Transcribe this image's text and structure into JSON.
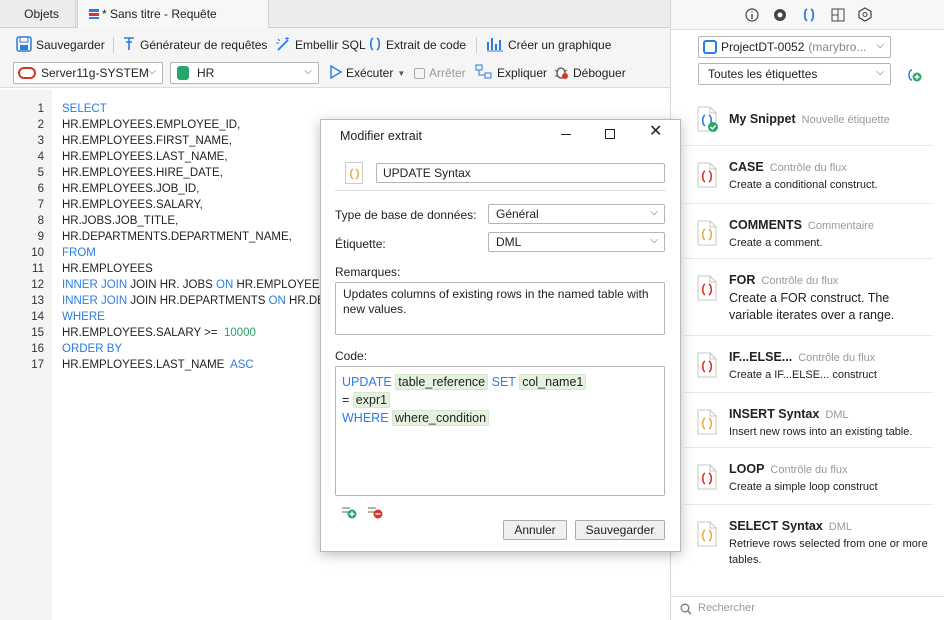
{
  "tabs": {
    "objects": "Objets",
    "query": "* Sans titre - Requête"
  },
  "toolbar": {
    "save": "Sauvegarder",
    "query_builder": "Générateur de requêtes",
    "beautify": "Embellir SQL",
    "code_snippet": "Extrait de code",
    "create_chart": "Créer un graphique",
    "connection": "Server11g-SYSTEM",
    "schema": "HR",
    "run": "Exécuter",
    "stop": "Arrêter",
    "explain": "Expliquer",
    "debug": "Déboguer"
  },
  "editor": {
    "lines": [
      {
        "n": "1",
        "parts": [
          {
            "t": "SELECT",
            "c": "kw"
          }
        ]
      },
      {
        "n": "2",
        "parts": [
          {
            "t": "HR.EMPLOYEES.EMPLOYEE_ID,"
          }
        ]
      },
      {
        "n": "3",
        "parts": [
          {
            "t": "HR.EMPLOYEES.FIRST_NAME,"
          }
        ]
      },
      {
        "n": "4",
        "parts": [
          {
            "t": "HR.EMPLOYEES.LAST_NAME,"
          }
        ]
      },
      {
        "n": "5",
        "parts": [
          {
            "t": "HR.EMPLOYEES.HIRE_DATE,"
          }
        ]
      },
      {
        "n": "6",
        "parts": [
          {
            "t": "HR.EMPLOYEES.JOB_ID,"
          }
        ]
      },
      {
        "n": "7",
        "parts": [
          {
            "t": "HR.EMPLOYEES.SALARY,"
          }
        ]
      },
      {
        "n": "8",
        "parts": [
          {
            "t": "HR.JOBS.JOB_TITLE,"
          }
        ]
      },
      {
        "n": "9",
        "parts": [
          {
            "t": "HR.DEPARTMENTS.DEPARTMENT_NAME,"
          }
        ]
      },
      {
        "n": "10",
        "parts": [
          {
            "t": "FROM",
            "c": "kw"
          }
        ]
      },
      {
        "n": "11",
        "parts": [
          {
            "t": "HR.EMPLOYEES"
          }
        ]
      },
      {
        "n": "12",
        "parts": [
          {
            "t": "INNER JOIN",
            "c": "kw"
          },
          {
            "t": " JOIN HR. JOBS "
          },
          {
            "t": "ON",
            "c": "kw"
          },
          {
            "t": " HR.EMPLOYEES"
          }
        ]
      },
      {
        "n": "13",
        "parts": [
          {
            "t": "INNER JOIN",
            "c": "kw"
          },
          {
            "t": " JOIN HR.DEPARTMENTS "
          },
          {
            "t": "ON",
            "c": "kw"
          },
          {
            "t": " HR.DE"
          }
        ]
      },
      {
        "n": "14",
        "parts": [
          {
            "t": "WHERE",
            "c": "kw"
          }
        ]
      },
      {
        "n": "15",
        "parts": [
          {
            "t": "HR.EMPLOYEES.SALARY >=  "
          },
          {
            "t": "10000",
            "c": "num"
          }
        ]
      },
      {
        "n": "16",
        "parts": [
          {
            "t": "ORDER BY",
            "c": "kw"
          }
        ]
      },
      {
        "n": "17",
        "parts": [
          {
            "t": "HR.EMPLOYEES.LAST_NAME  "
          },
          {
            "t": "ASC",
            "c": "kw"
          }
        ]
      }
    ]
  },
  "dialog": {
    "title": "Modifier extrait",
    "name": "UPDATE Syntax",
    "db_type_label": "Type de base de données:",
    "db_type_value": "Général",
    "tag_label": "Étiquette:",
    "tag_value": "DML",
    "remarks_label": "Remarques:",
    "remarks_value": "Updates columns of existing rows in the named table with new values.",
    "code_label": "Code:",
    "code": {
      "kw_update": "UPDATE",
      "tok_table": "table_reference",
      "kw_set": "SET",
      "tok_col": "col_name1",
      "eq": "=",
      "tok_expr": "expr1",
      "kw_where": "WHERE",
      "tok_where": "where_condition"
    },
    "cancel": "Annuler",
    "save": "Sauvegarder"
  },
  "panel": {
    "project": "ProjectDT-0052",
    "project_user": "(marybro...",
    "tag_filter": "Toutes les étiquettes",
    "search_placeholder": "Rechercher",
    "snippets": [
      {
        "title": "My Snippet",
        "tag": "Nouvelle étiquette",
        "desc": "",
        "color": "#2a7de1"
      },
      {
        "title": "CASE",
        "tag": "Contrôle du flux",
        "desc": "Create a conditional construct.",
        "color": "#d9342b"
      },
      {
        "title": "COMMENTS",
        "tag": "Commentaire",
        "desc": "Create a comment.",
        "color": "#e0b341"
      },
      {
        "title": "FOR",
        "tag": "Contrôle du flux",
        "desc": "Create a FOR construct. The variable iterates over a range.",
        "color": "#d9342b"
      },
      {
        "title": "IF...ELSE...",
        "tag": "Contrôle du flux",
        "desc": "Create a IF...ELSE... construct",
        "color": "#d9342b"
      },
      {
        "title": "INSERT Syntax",
        "tag": "DML",
        "desc": "Insert new rows into an existing table.",
        "color": "#e0b341"
      },
      {
        "title": "LOOP",
        "tag": "Contrôle du flux",
        "desc": "Create a simple loop construct",
        "color": "#d9342b"
      },
      {
        "title": "SELECT Syntax",
        "tag": "DML",
        "desc": "Retrieve rows selected from one or more tables.",
        "color": "#e0b341"
      }
    ]
  },
  "colors": {
    "keyword": "#2a7de1",
    "number": "#2aa56b",
    "token_bg": "#e6f2e0"
  }
}
